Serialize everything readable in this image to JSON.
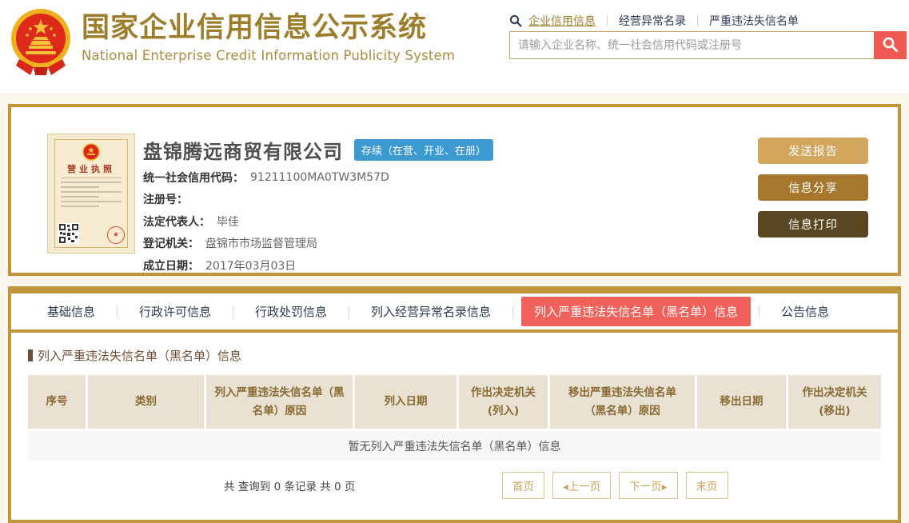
{
  "colors": {
    "gold_border": "#c2953c",
    "title_gold": "#9d7e2c",
    "nav_navy": "#2e3a52",
    "accent_red": "#ee5a52",
    "status_blue": "#3d9ad1",
    "table_header_bg": "#e9e2d3",
    "table_header_text": "#8a6a33",
    "page_background": "#faf6ec"
  },
  "header": {
    "title": "国家企业信用信息公示系统",
    "subtitle": "National Enterprise Credit Information Publicity System",
    "nav": [
      {
        "label": "企业信用信息",
        "active": true
      },
      {
        "label": "经营异常名录",
        "active": false
      },
      {
        "label": "严重违法失信名单",
        "active": false
      }
    ],
    "search": {
      "placeholder": "请输入企业名称、统一社会信用代码或注册号"
    }
  },
  "company": {
    "name": "盘锦腾远商贸有限公司",
    "status_badge": "存续（在营、开业、在册）",
    "license_title": "营业执照",
    "fields": [
      {
        "label": "统一社会信用代码：",
        "value": "91211100MA0TW3M57D"
      },
      {
        "label": "注册号：",
        "value": ""
      },
      {
        "label": "法定代表人：",
        "value": "毕佳"
      },
      {
        "label": "登记机关：",
        "value": "盘锦市市场监督管理局"
      },
      {
        "label": "成立日期：",
        "value": "2017年03月03日"
      }
    ],
    "actions": [
      {
        "label": "发送报告",
        "color": "#d2a65c"
      },
      {
        "label": "信息分享",
        "color": "#a5782e"
      },
      {
        "label": "信息打印",
        "color": "#5a4721"
      }
    ]
  },
  "tabs": [
    {
      "label": "基础信息",
      "active": false
    },
    {
      "label": "行政许可信息",
      "active": false
    },
    {
      "label": "行政处罚信息",
      "active": false
    },
    {
      "label": "列入经营异常名录信息",
      "active": false
    },
    {
      "label": "列入严重违法失信名单（黑名单）信息",
      "active": true
    },
    {
      "label": "公告信息",
      "active": false
    }
  ],
  "section": {
    "title": "列入严重违法失信名单（黑名单）信息",
    "table": {
      "headers": [
        "序号",
        "类别",
        "列入严重违法失信名单（黑名单）原因",
        "列入日期",
        "作出决定机关(列入)",
        "移出严重违法失信名单（黑名单）原因",
        "移出日期",
        "作出决定机关(移出)"
      ],
      "empty_text": "暂无列入严重违法失信名单（黑名单）信息"
    },
    "pagination": {
      "summary": "共 查询到 0 条记录 共 0 页",
      "buttons": [
        "首页",
        "◂上一页",
        "下一页▸",
        "末页"
      ]
    }
  }
}
